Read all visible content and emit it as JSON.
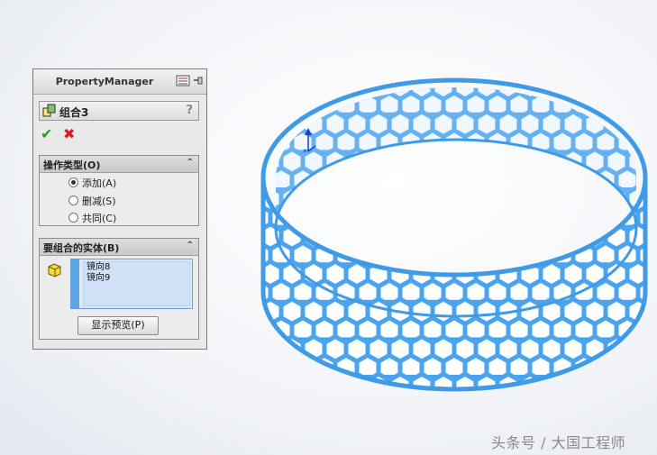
{
  "property_manager": {
    "title": "PropertyManager",
    "feature_name": "组合3",
    "help_glyph": "?",
    "ok_glyph": "✔",
    "cancel_glyph": "✖"
  },
  "operation_type": {
    "title": "操作类型(O)",
    "options": [
      {
        "label": "添加(A)",
        "selected": true
      },
      {
        "label": "删减(S)",
        "selected": false
      },
      {
        "label": "共同(C)",
        "selected": false
      }
    ]
  },
  "bodies": {
    "title": "要组合的实体(B)",
    "items": [
      "镜向8",
      "镜向9"
    ],
    "preview_button": "显示预览(P)"
  },
  "watermark": "头条号 / 大国工程师",
  "colors": {
    "model": "#4aa3ef",
    "accent": "#5aa6e6"
  },
  "icons": [
    "property-manager-icon",
    "pin-icon",
    "combine-feature-icon",
    "help-icon",
    "ok-icon",
    "cancel-icon",
    "collapse-icon",
    "solid-body-icon",
    "triad-icon"
  ]
}
